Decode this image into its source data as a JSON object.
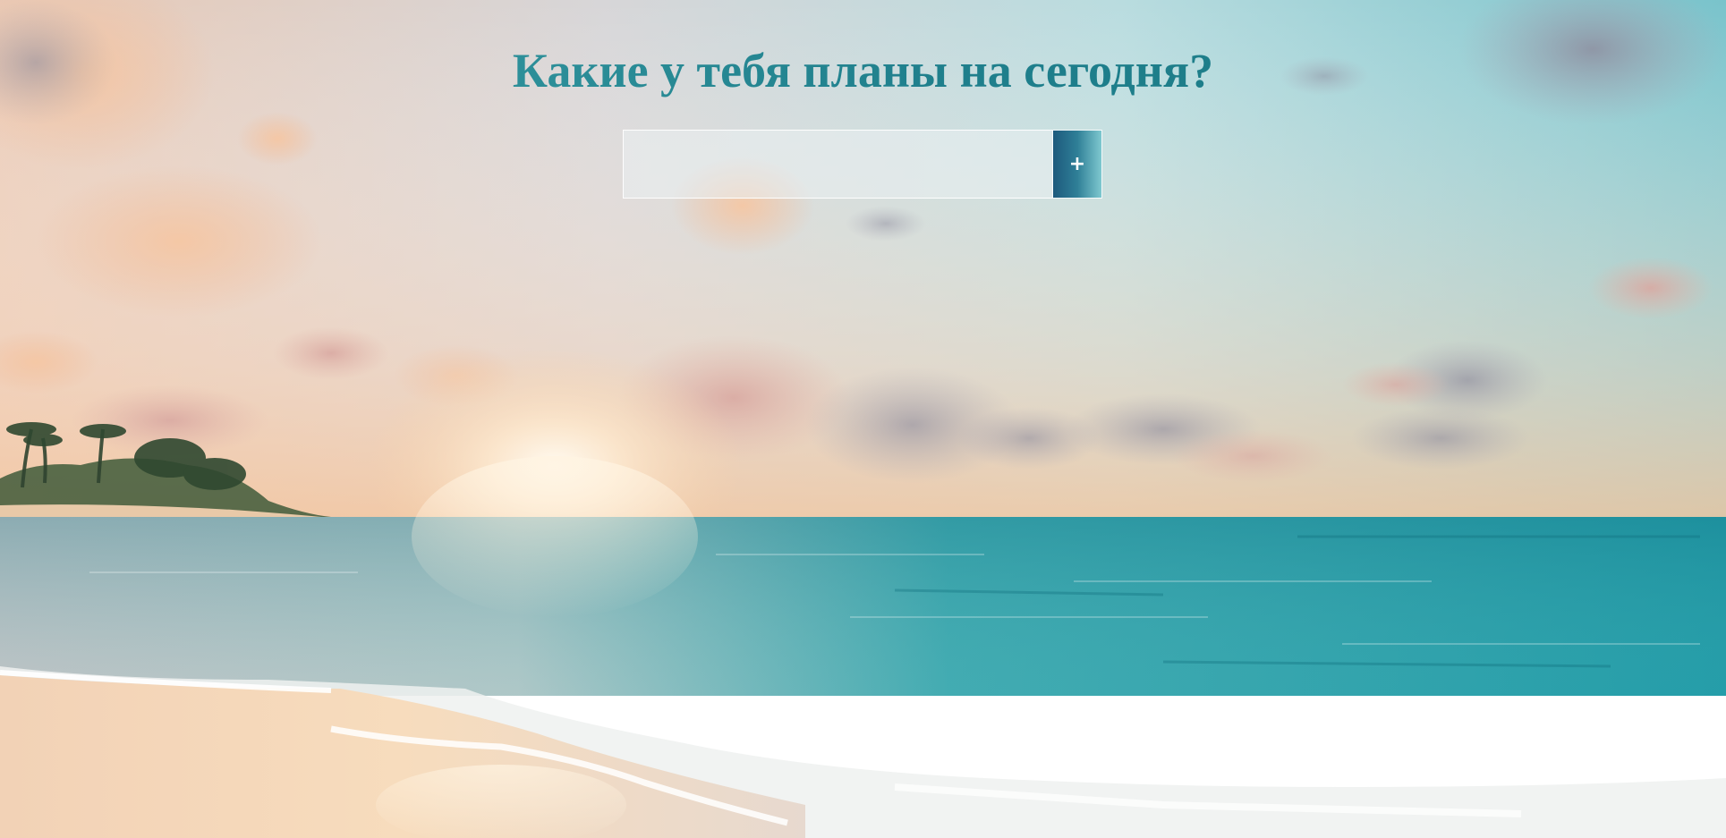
{
  "page": {
    "title": "Какие у тебя планы на сегодня?"
  },
  "todo_form": {
    "input_value": "",
    "input_placeholder": "",
    "add_button_label": "+"
  },
  "background": {
    "icon": "beach-sunset-image"
  },
  "colors": {
    "title_gradient_start": "#4ba7ad",
    "title_gradient_end": "#1a7b86",
    "button_gradient_start": "#1d5a7d",
    "button_gradient_end": "#7ec8cf"
  }
}
